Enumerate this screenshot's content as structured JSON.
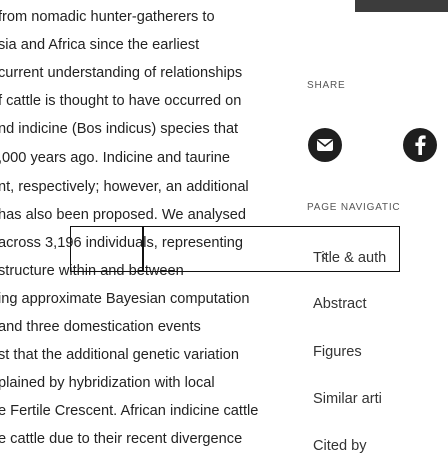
{
  "abstract": {
    "lines": [
      "from nomadic hunter-gatherers to",
      "sia and Africa since the earliest",
      "current understanding of relationships",
      "f cattle is thought to have occurred on",
      "nd indicine (Bos indicus) species that",
      ",000 years ago. Indicine and taurine",
      "nt, respectively; however, an additional",
      "has also been proposed. We analysed",
      "across 3,196 individuals, representing",
      "structure within and between",
      "ing approximate Bayesian computation",
      "and three domestication events",
      "st that the additional genetic variation",
      "plained by hybridization with local",
      "e Fertile Crescent. African indicine cattle",
      "e cattle due to their recent divergence"
    ]
  },
  "sidebar": {
    "share_label": "SHARE",
    "mail_icon": "mail-icon",
    "facebook_icon": "facebook-icon",
    "page_nav_label": "PAGE NAVIGATIC",
    "nav_items": [
      "Title & auth",
      "Abstract",
      "Figures",
      "Similar arti",
      "Cited by"
    ]
  },
  "colors": {
    "text": "#222222",
    "button_bg": "#1f1f1f",
    "banner": "#3c3c3c"
  }
}
